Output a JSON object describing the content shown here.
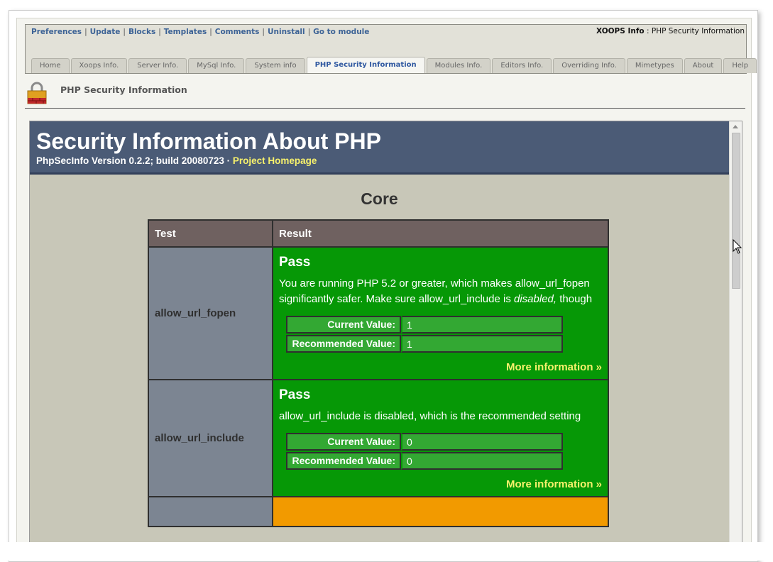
{
  "admin_menu": {
    "links": [
      "Preferences",
      "Update",
      "Blocks",
      "Templates",
      "Comments",
      "Uninstall",
      "Go to module"
    ],
    "module_name": "XOOPS Info",
    "separator": ":",
    "current_page": "PHP Security Information"
  },
  "tabs": [
    {
      "label": "Home",
      "active": false
    },
    {
      "label": "Xoops Info.",
      "active": false
    },
    {
      "label": "Server Info.",
      "active": false
    },
    {
      "label": "MySql Info.",
      "active": false
    },
    {
      "label": "System info",
      "active": false
    },
    {
      "label": "PHP Security Information",
      "active": true
    },
    {
      "label": "Modules Info.",
      "active": false
    },
    {
      "label": "Editors Info.",
      "active": false
    },
    {
      "label": "Overriding Info.",
      "active": false
    },
    {
      "label": "Mimetypes",
      "active": false
    },
    {
      "label": "About",
      "active": false
    },
    {
      "label": "Help",
      "active": false
    }
  ],
  "page": {
    "title": "PHP Security Information",
    "icon": "padlock-icon"
  },
  "phpsecinfo": {
    "heading": "Security Information About PHP",
    "version_line": "PhpSecInfo Version 0.2.2; build 20080723 · ",
    "homepage_link": "Project Homepage",
    "section": "Core",
    "col_test": "Test",
    "col_result": "Result",
    "rows": [
      {
        "test": "allow_url_fopen",
        "status": "Pass",
        "desc_before": "You are running PHP 5.2 or greater, which makes allow_url_fopen significantly safer. Make sure allow_url_include is ",
        "desc_emph": "disabled,",
        "desc_after": " though",
        "current_label": "Current Value:",
        "current_value": "1",
        "recommended_label": "Recommended Value:",
        "recommended_value": "1",
        "more": "More information »"
      },
      {
        "test": "allow_url_include",
        "status": "Pass",
        "desc_before": "allow_url_include is disabled, which is the recommended setting",
        "desc_emph": "",
        "desc_after": "",
        "current_label": "Current Value:",
        "current_value": "0",
        "recommended_label": "Recommended Value:",
        "recommended_value": "0",
        "more": "More information »"
      }
    ]
  },
  "colors": {
    "pass": "#069806",
    "warn": "#f29a00",
    "header": "#4b5b76",
    "link_yellow": "#f7f16c"
  }
}
